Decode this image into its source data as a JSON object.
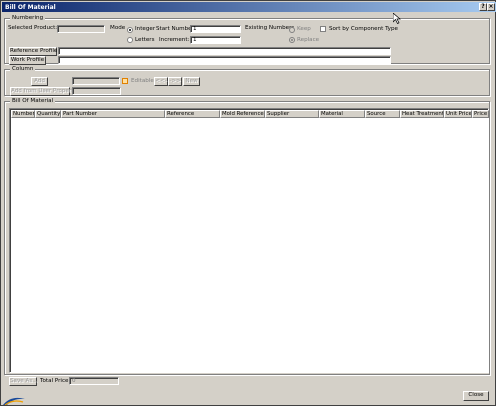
{
  "window": {
    "title": "Bill Of Material",
    "help_label": "?",
    "close_label": "×"
  },
  "numbering": {
    "group_label": "Numbering",
    "selected_product_label": "Selected Product:",
    "mode_label": "Mode",
    "integer_label": "Integer",
    "letters_label": "Letters",
    "mode_selected": "Integer",
    "start_number_label": "Start Number:",
    "start_number_value": "1",
    "increment_label": "Increment:",
    "increment_value": "1",
    "existing_numbers_label": "Existing Numbers",
    "keep_label": "Keep",
    "replace_label": "Replace",
    "existing_selected": "Replace",
    "sort_label": "Sort by Component Type",
    "sort_checked": false,
    "reference_profile_label": "Reference Profile",
    "reference_profile_value": "",
    "work_profile_label": "Work Profile",
    "work_profile_value": ""
  },
  "column": {
    "group_label": "Column",
    "add_label": "Add",
    "editable_label": "Editable",
    "move_left_label": "<<-",
    "move_right_label": "->>",
    "new_label": "New",
    "add_user_property_label": "Add from User Property"
  },
  "bom": {
    "group_label": "Bill Of Material",
    "columns": [
      "Number",
      "Quantity",
      "Part Number",
      "Reference",
      "Mold Reference",
      "Supplier",
      "Material",
      "Source",
      "Heat Treatment",
      "Unit Price",
      "Price"
    ]
  },
  "footer": {
    "save_as_label": "Save As...",
    "total_price_label": "Total Price:",
    "total_price_value": "0",
    "close_label": "Close"
  },
  "colors": {
    "title_start": "#0a246a",
    "title_end": "#a6caf0",
    "face": "#d4d0c8"
  }
}
